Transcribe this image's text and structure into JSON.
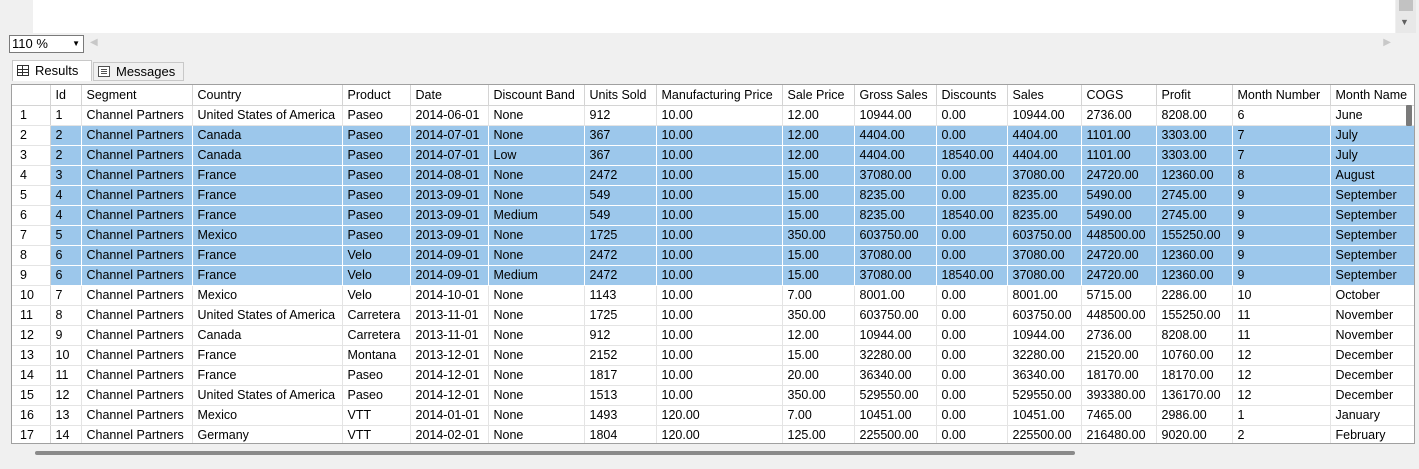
{
  "zoom": {
    "value": "110 %"
  },
  "tabs": [
    {
      "label": "Results",
      "icon": "grid-icon",
      "active": true
    },
    {
      "label": "Messages",
      "icon": "messages-icon",
      "active": false
    }
  ],
  "grid": {
    "columns": [
      "",
      "Id",
      "Segment",
      "Country",
      "Product",
      "Date",
      "Discount Band",
      "Units Sold",
      "Manufacturing Price",
      "Sale Price",
      "Gross Sales",
      "Discounts",
      "Sales",
      "COGS",
      "Profit",
      "Month Number",
      "Month Name"
    ],
    "selected_rows": [
      2,
      3,
      4,
      5,
      6,
      7,
      8,
      9
    ],
    "selection_color": "#9cc7eb",
    "rows": [
      [
        "1",
        "1",
        "Channel Partners",
        "United States of America",
        "Paseo",
        "2014-06-01",
        "None",
        "912",
        "10.00",
        "12.00",
        "10944.00",
        "0.00",
        "10944.00",
        "2736.00",
        "8208.00",
        "6",
        "June"
      ],
      [
        "2",
        "2",
        "Channel Partners",
        "Canada",
        "Paseo",
        "2014-07-01",
        "None",
        "367",
        "10.00",
        "12.00",
        "4404.00",
        "0.00",
        "4404.00",
        "1101.00",
        "3303.00",
        "7",
        "July"
      ],
      [
        "3",
        "2",
        "Channel Partners",
        "Canada",
        "Paseo",
        "2014-07-01",
        "Low",
        "367",
        "10.00",
        "12.00",
        "4404.00",
        "18540.00",
        "4404.00",
        "1101.00",
        "3303.00",
        "7",
        "July"
      ],
      [
        "4",
        "3",
        "Channel Partners",
        "France",
        "Paseo",
        "2014-08-01",
        "None",
        "2472",
        "10.00",
        "15.00",
        "37080.00",
        "0.00",
        "37080.00",
        "24720.00",
        "12360.00",
        "8",
        "August"
      ],
      [
        "5",
        "4",
        "Channel Partners",
        "France",
        "Paseo",
        "2013-09-01",
        "None",
        "549",
        "10.00",
        "15.00",
        "8235.00",
        "0.00",
        "8235.00",
        "5490.00",
        "2745.00",
        "9",
        "September"
      ],
      [
        "6",
        "4",
        "Channel Partners",
        "France",
        "Paseo",
        "2013-09-01",
        "Medium",
        "549",
        "10.00",
        "15.00",
        "8235.00",
        "18540.00",
        "8235.00",
        "5490.00",
        "2745.00",
        "9",
        "September"
      ],
      [
        "7",
        "5",
        "Channel Partners",
        "Mexico",
        "Paseo",
        "2013-09-01",
        "None",
        "1725",
        "10.00",
        "350.00",
        "603750.00",
        "0.00",
        "603750.00",
        "448500.00",
        "155250.00",
        "9",
        "September"
      ],
      [
        "8",
        "6",
        "Channel Partners",
        "France",
        "Velo",
        "2014-09-01",
        "None",
        "2472",
        "10.00",
        "15.00",
        "37080.00",
        "0.00",
        "37080.00",
        "24720.00",
        "12360.00",
        "9",
        "September"
      ],
      [
        "9",
        "6",
        "Channel Partners",
        "France",
        "Velo",
        "2014-09-01",
        "Medium",
        "2472",
        "10.00",
        "15.00",
        "37080.00",
        "18540.00",
        "37080.00",
        "24720.00",
        "12360.00",
        "9",
        "September"
      ],
      [
        "10",
        "7",
        "Channel Partners",
        "Mexico",
        "Velo",
        "2014-10-01",
        "None",
        "1143",
        "10.00",
        "7.00",
        "8001.00",
        "0.00",
        "8001.00",
        "5715.00",
        "2286.00",
        "10",
        "October"
      ],
      [
        "11",
        "8",
        "Channel Partners",
        "United States of America",
        "Carretera",
        "2013-11-01",
        "None",
        "1725",
        "10.00",
        "350.00",
        "603750.00",
        "0.00",
        "603750.00",
        "448500.00",
        "155250.00",
        "11",
        "November"
      ],
      [
        "12",
        "9",
        "Channel Partners",
        "Canada",
        "Carretera",
        "2013-11-01",
        "None",
        "912",
        "10.00",
        "12.00",
        "10944.00",
        "0.00",
        "10944.00",
        "2736.00",
        "8208.00",
        "11",
        "November"
      ],
      [
        "13",
        "10",
        "Channel Partners",
        "France",
        "Montana",
        "2013-12-01",
        "None",
        "2152",
        "10.00",
        "15.00",
        "32280.00",
        "0.00",
        "32280.00",
        "21520.00",
        "10760.00",
        "12",
        "December"
      ],
      [
        "14",
        "11",
        "Channel Partners",
        "France",
        "Paseo",
        "2014-12-01",
        "None",
        "1817",
        "10.00",
        "20.00",
        "36340.00",
        "0.00",
        "36340.00",
        "18170.00",
        "18170.00",
        "12",
        "December"
      ],
      [
        "15",
        "12",
        "Channel Partners",
        "United States of America",
        "Paseo",
        "2014-12-01",
        "None",
        "1513",
        "10.00",
        "350.00",
        "529550.00",
        "0.00",
        "529550.00",
        "393380.00",
        "136170.00",
        "12",
        "December"
      ],
      [
        "16",
        "13",
        "Channel Partners",
        "Mexico",
        "VTT",
        "2014-01-01",
        "None",
        "1493",
        "120.00",
        "7.00",
        "10451.00",
        "0.00",
        "10451.00",
        "7465.00",
        "2986.00",
        "1",
        "January"
      ],
      [
        "17",
        "14",
        "Channel Partners",
        "Germany",
        "VTT",
        "2014-02-01",
        "None",
        "1804",
        "120.00",
        "125.00",
        "225500.00",
        "0.00",
        "225500.00",
        "216480.00",
        "9020.00",
        "2",
        "February"
      ]
    ]
  }
}
